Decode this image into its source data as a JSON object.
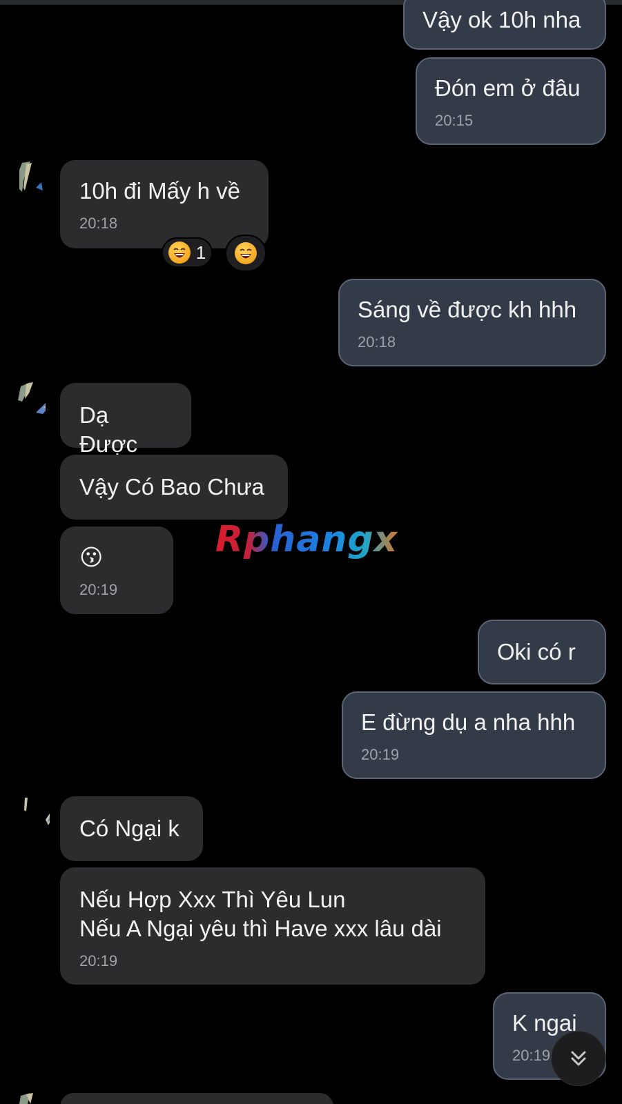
{
  "messages": [
    {
      "text": "Vậy ok 10h nha",
      "time": ""
    },
    {
      "text": "Đón em ở đâu",
      "time": "20:15"
    },
    {
      "text": "10h đi Mấy h về",
      "time": "20:18"
    },
    {
      "text": "Sáng về được kh hhh",
      "time": "20:18"
    },
    {
      "text": "Dạ Được",
      "time": ""
    },
    {
      "text": "Vậy Có Bao Chưa",
      "time": ""
    },
    {
      "text": "😗",
      "time": "20:19"
    },
    {
      "text": "Oki có r",
      "time": ""
    },
    {
      "text": "E đừng dụ a nha hhh",
      "time": "20:19"
    },
    {
      "text": "Có Ngại k",
      "time": ""
    },
    {
      "text": "Nếu Hợp Xxx Thì Yêu Lun\nNếu A Ngại yêu thì Have xxx lâu dài",
      "time": "20:19"
    },
    {
      "text": "K ngai",
      "time": "20:19"
    }
  ],
  "reactions": {
    "count_label": "1",
    "icon": "laughing-face-icon"
  },
  "watermark": "Rphangx",
  "scroll_button": {
    "icon": "double-chevron-down-icon"
  },
  "colors": {
    "background": "#000000",
    "outgoing_bubble": "#333b48",
    "outgoing_border": "#5a6576",
    "incoming_bubble": "#2c2c2e",
    "timestamp": "#9ea2a8"
  }
}
